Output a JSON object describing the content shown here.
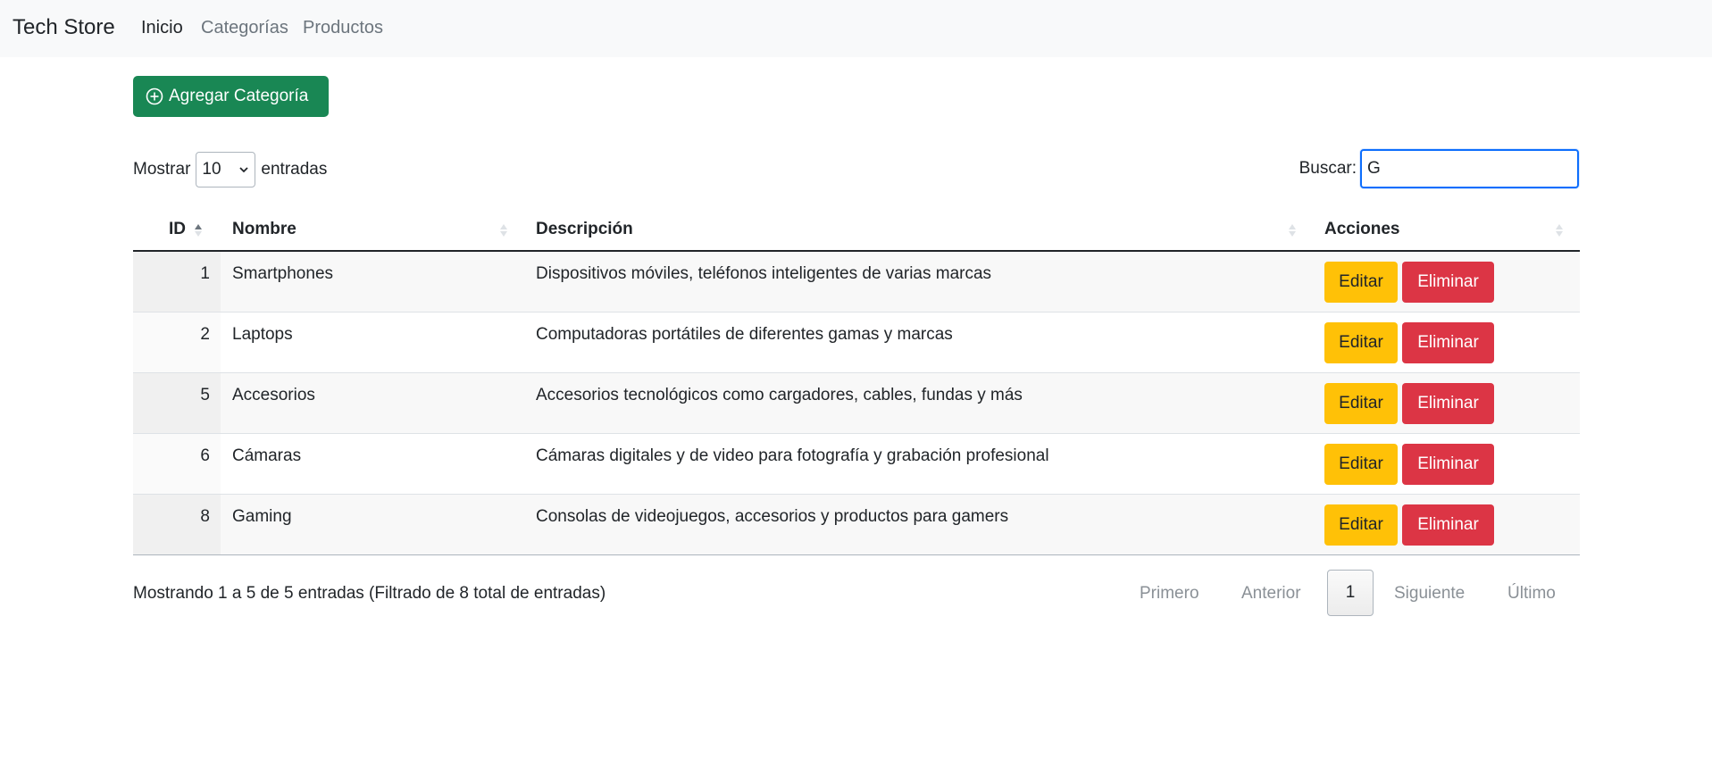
{
  "navbar": {
    "brand": "Tech Store",
    "links": [
      {
        "label": "Inicio",
        "active": true
      },
      {
        "label": "Categorías",
        "active": false
      },
      {
        "label": "Productos",
        "active": false
      }
    ]
  },
  "toolbar": {
    "add_label": "Agregar Categoría",
    "add_icon": "plus-circle-icon"
  },
  "length": {
    "prefix": "Mostrar",
    "value": "10",
    "suffix": "entradas"
  },
  "search": {
    "label": "Buscar:",
    "value": "G"
  },
  "table": {
    "headers": [
      "ID",
      "Nombre",
      "Descripción",
      "Acciones"
    ],
    "rows": [
      {
        "id": "1",
        "nombre": "Smartphones",
        "descripcion": "Dispositivos móviles, teléfonos inteligentes de varias marcas"
      },
      {
        "id": "2",
        "nombre": "Laptops",
        "descripcion": "Computadoras portátiles de diferentes gamas y marcas"
      },
      {
        "id": "5",
        "nombre": "Accesorios",
        "descripcion": "Accesorios tecnológicos como cargadores, cables, fundas y más"
      },
      {
        "id": "6",
        "nombre": "Cámaras",
        "descripcion": "Cámaras digitales y de video para fotografía y grabación profesional"
      },
      {
        "id": "8",
        "nombre": "Gaming",
        "descripcion": "Consolas de videojuegos, accesorios y productos para gamers"
      }
    ],
    "edit_label": "Editar",
    "delete_label": "Eliminar"
  },
  "footer": {
    "info": "Mostrando 1 a 5 de 5 entradas (Filtrado de 8 total de entradas)",
    "pagination": {
      "first": "Primero",
      "prev": "Anterior",
      "current": "1",
      "next": "Siguiente",
      "last": "Último"
    }
  },
  "colors": {
    "primary_success": "#198754",
    "warning": "#ffc107",
    "danger": "#dc3545",
    "focus": "#0d6efd"
  }
}
